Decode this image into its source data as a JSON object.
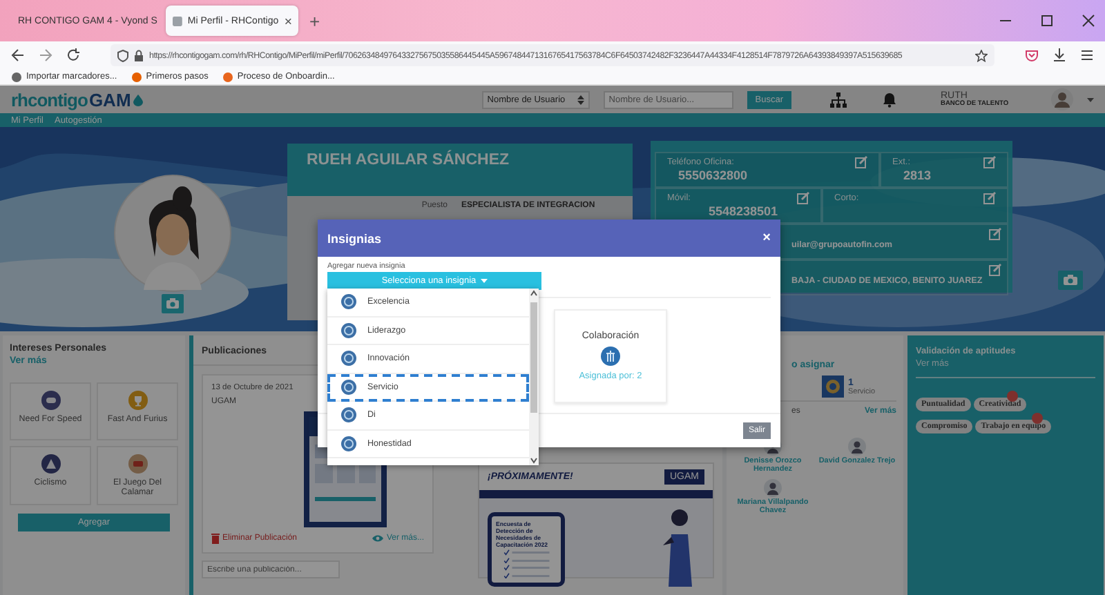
{
  "browser": {
    "tabs": [
      {
        "title": "RH CONTIGO GAM 4 - Vyond S",
        "selected": false
      },
      {
        "title": "Mi Perfil - RHContigo",
        "selected": true
      }
    ],
    "new_tab": "+",
    "url": "https://rhcontigogam.com/rh/RHContigo/MiPerfil/miPerfil/706263484976433275675035586445445A5967484471316765417563784C6F64503742482F3236447A44334F4128514F7879726A64393849397A515639685",
    "bookmarks": [
      "Importar marcadores...",
      "Primeros pasos",
      "Proceso de Onboardin..."
    ]
  },
  "header": {
    "logo_1": "rhcontigo",
    "logo_2": "GAM",
    "search_type": "Nombre de Usuario",
    "search": {
      "placeholder": "Nombre de Usuario..."
    },
    "search_button": "Buscar",
    "user_name": "RUTH",
    "user_role": "BANCO DE TALENTO"
  },
  "nav": [
    "Mi Perfil",
    "Autogestión"
  ],
  "profile": {
    "name": "RUEH AGUILAR SÁNCHEZ",
    "details": [
      {
        "label": "Puesto",
        "value": "ESPECIALISTA DE INTEGRACION"
      }
    ]
  },
  "contact": {
    "fields": [
      {
        "label": "Teléfono Oficina:",
        "value": "5550632800"
      },
      {
        "label": "Ext.:",
        "value": "2813"
      },
      {
        "label": "Móvil:",
        "value": "5548238501"
      },
      {
        "label": "Corto:"
      },
      {
        "value": "uilar@grupoautofin.com"
      },
      {
        "value": "BAJA - CIUDAD DE MEXICO, BENITO JUAREZ"
      }
    ]
  },
  "interests": {
    "title": "Intereses Personales",
    "more": "Ver más",
    "items": [
      {
        "label": "Need For Speed",
        "kind": "controller"
      },
      {
        "label": "Fast And Furius",
        "kind": "trophy"
      },
      {
        "label": "Ciclismo",
        "kind": "tent"
      },
      {
        "label": "El Juego Del Calamar",
        "kind": "bus"
      }
    ],
    "add_button": "Agregar"
  },
  "publications": {
    "title": "Publicaciones",
    "posts": [
      {
        "date": "13 de Octubre de 2021",
        "author": "UGAM",
        "delete": "Eliminar Publicación",
        "more": "Ver más..."
      }
    ],
    "poster": {
      "headline": "¡PRÓXIMAMENTE!",
      "brand": "UGAM",
      "title": "Encuesta de Detección de Necesidades de Capacitación 2022"
    },
    "composer": {
      "placeholder": "Escribe una publicación..."
    }
  },
  "recognition": {
    "title": "o asignar",
    "stat": {
      "count": "1",
      "label": "Servicio"
    },
    "people_title": "es",
    "more": "Ver más",
    "people": [
      {
        "name": "Denisse Orozco Hernandez"
      },
      {
        "name": "David Gonzalez Trejo"
      },
      {
        "name": "Mariana Villalpando Chavez"
      }
    ]
  },
  "skills": {
    "title": "Validación de aptitudes",
    "more": "Ver más",
    "tags": [
      {
        "label": "Puntualidad",
        "badge": false
      },
      {
        "label": "Creatividad",
        "badge": true
      },
      {
        "label": "Compromiso",
        "badge": false
      },
      {
        "label": "Trabajo en equipo",
        "badge": true
      }
    ]
  },
  "modal": {
    "title": "Insignias",
    "close": "×",
    "add_label": "Agregar nueva insignia",
    "select": "Selecciona una insignia",
    "options": [
      {
        "label": "Excelencia",
        "selected": false
      },
      {
        "label": "Liderazgo",
        "selected": false
      },
      {
        "label": "Innovación",
        "selected": false
      },
      {
        "label": "Servicio",
        "selected": true
      },
      {
        "label": "Di",
        "selected": false
      },
      {
        "label": "Honestidad",
        "selected": false
      }
    ],
    "cards": [
      {
        "title": "Colaboración",
        "assigned": "Asignada por: 2"
      }
    ],
    "exit_button": "Salir"
  }
}
